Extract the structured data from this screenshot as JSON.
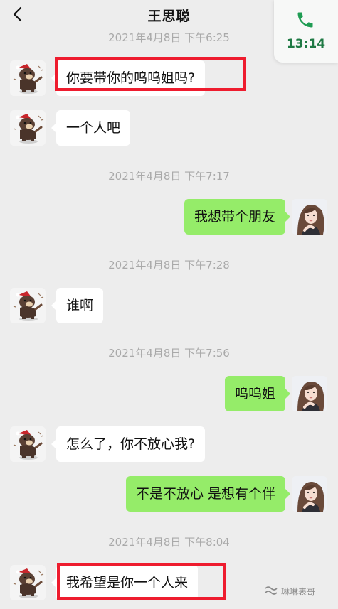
{
  "header": {
    "title": "王思聪",
    "back_icon": "chevron-left-icon"
  },
  "call": {
    "time": "13:14",
    "icon": "phone-icon",
    "color": "#1f9c53"
  },
  "timestamps": [
    "2021年4月8日 下午6:25",
    "2021年4月8日 下午7:17",
    "2021年4月8日 下午7:28",
    "2021年4月8日 下午7:56",
    "2021年4月8日 下午8:04"
  ],
  "messages": [
    {
      "side": "in",
      "text": "你要带你的呜呜姐吗?",
      "highlighted": true
    },
    {
      "side": "in",
      "text": "一个人吧"
    },
    {
      "side": "out",
      "text": "我想带个朋友"
    },
    {
      "side": "in",
      "text": "谁啊"
    },
    {
      "side": "out",
      "text": "呜呜姐"
    },
    {
      "side": "in",
      "text": "怎么了，你不放心我?"
    },
    {
      "side": "out",
      "text": "不是不放心 是想有个伴"
    },
    {
      "side": "in",
      "text": "我希望是你一个人来",
      "highlighted": true
    }
  ],
  "watermark": {
    "text": "琳琳表哥",
    "icon": "wechat-channel-icon"
  },
  "colors": {
    "outgoing_bubble": "#95ec69",
    "incoming_bubble": "#ffffff",
    "highlight": "#ee1c2e",
    "background": "#ededed"
  }
}
